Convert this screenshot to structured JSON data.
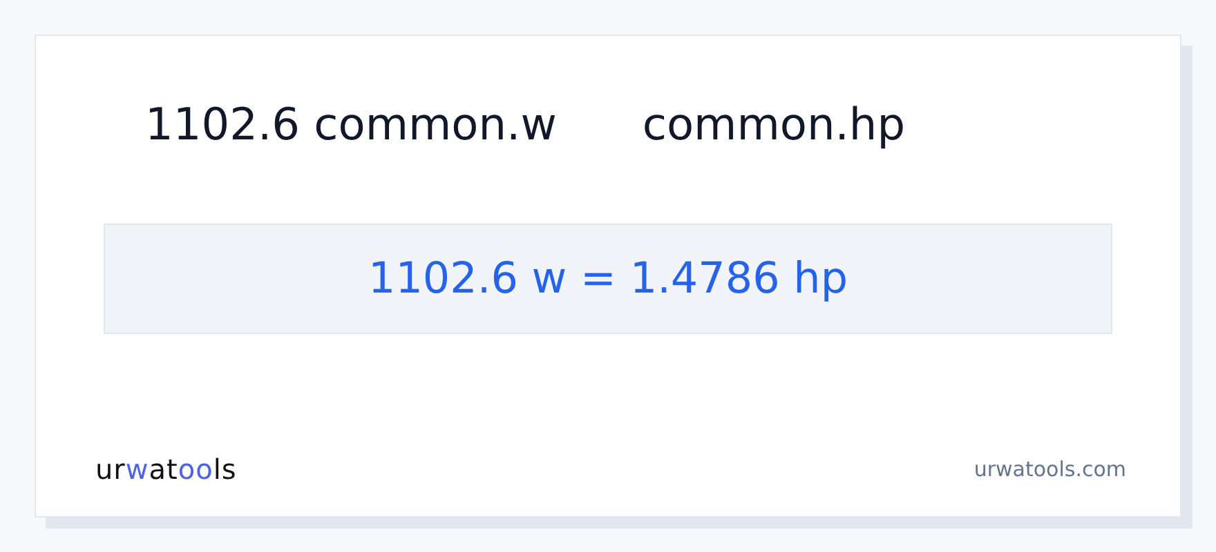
{
  "heading": {
    "from": "1102.6 common.w",
    "to": "common.hp"
  },
  "result": "1102.6 w = 1.4786 hp",
  "logo": [
    {
      "text": "ur",
      "accent": false
    },
    {
      "text": "w",
      "accent": true
    },
    {
      "text": "at",
      "accent": false
    },
    {
      "text": "oo",
      "accent": true
    },
    {
      "text": "ls",
      "accent": false
    }
  ],
  "site": "urwatools.com"
}
